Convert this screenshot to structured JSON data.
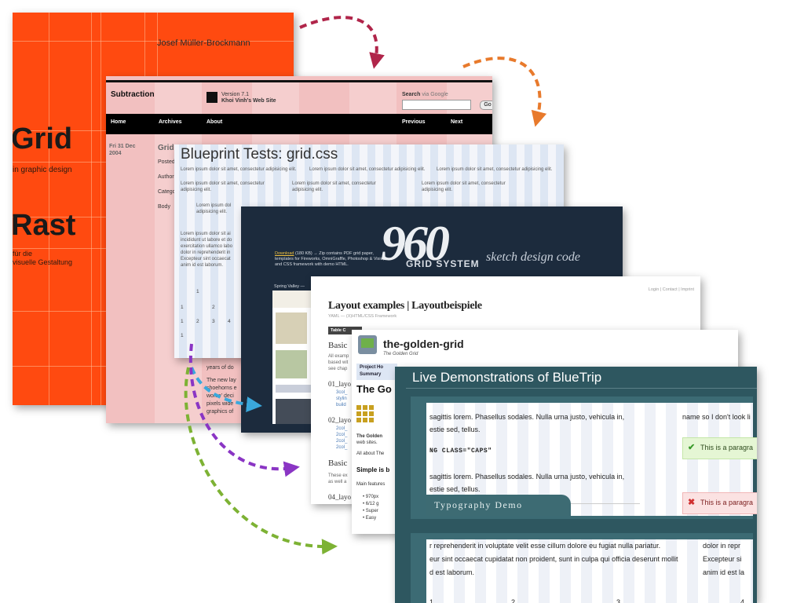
{
  "book": {
    "author": "Josef Müller-Brockmann",
    "title_1": "Grid",
    "subtitle": "in graphic design",
    "title_2": "Rast",
    "line_a": "für die",
    "line_b": "visuelle Gestaltung"
  },
  "subtraction": {
    "logo": "Subtraction",
    "version": "Version 7.1",
    "site_name": "Khoi Vinh’s Web Site",
    "search_label": "Search",
    "search_via": "via Google",
    "go_label": "Go",
    "nav": [
      "Home",
      "Archives",
      "About",
      "Previous",
      "Next"
    ],
    "date_line1": "Fri 31 Dec",
    "date_line2": "2004",
    "post_title": "Grid",
    "meta": [
      "Posted",
      "Author",
      "Catego",
      "Body"
    ],
    "body_text": [
      "years of do",
      "The new lay",
      "shoehorns e",
      "worse' deci",
      "pixels wide",
      "graphics of"
    ]
  },
  "blueprint": {
    "title": "Blueprint Tests: grid.css",
    "lorem_wide": "Lorem ipsum dolor sit amet, consectetur adipisicing elit.",
    "lorem_col_1": "Lorem ipsum dolor sit amet, consectetur",
    "lorem_col_2": "adipisicing elit.",
    "lorem_short_1": "Lorem ipsum dol",
    "lorem_short_2": "adipisicing elit.",
    "para": [
      "Lorem ipsum dolor sit ai",
      "incididunt ut labore et do",
      "exercitation ullamco labo",
      "dolor in reprehenderit in",
      "Excepteur sint occaecat",
      "anim id est laborum."
    ],
    "nums": [
      "1",
      "1",
      "2",
      "1",
      "2",
      "3",
      "4",
      "1"
    ]
  },
  "g960": {
    "logo": "960",
    "grid_system": "GRID SYSTEM",
    "tagline": "sketch design code",
    "download_link": "Download",
    "download_text": "(180 KB) → Zip contains PDF grid paper, templates for Fireworks, OmniGraffle, Photoshop & Visio, and CSS framework with demo HTML.",
    "inner_header": "Spring Valley —"
  },
  "yaml": {
    "login": "Login | Contact | Imprint",
    "title": "Layout examples | Layoutbeispiele",
    "subtitle": "YAML — (X)HTML/CSS Framework",
    "tab": "Table C",
    "basic1": "Basic",
    "intro": [
      "All examp",
      "based wit",
      "see chap"
    ],
    "layout01": "01_layo",
    "links01": [
      "3col_",
      "stylin",
      "build"
    ],
    "layout02": "02_layo",
    "links02": [
      "2col_",
      "2col_",
      "2col_",
      "2col_"
    ],
    "basic2": "Basic",
    "these": [
      "These ex",
      "as well a"
    ],
    "layout04": "04_layo"
  },
  "golden": {
    "title": "the-golden-grid",
    "tagline": "The Golden Grid",
    "proj_1": "Project Ho",
    "proj_2": "Summary",
    "heading": "The Go",
    "desc_bold": "The Golden",
    "desc_rest": "web sites.",
    "about": "All about The",
    "simple": "Simple is b",
    "features": "Main features",
    "bullets": [
      "970px",
      "6/12 g",
      "Super",
      "Easy"
    ]
  },
  "bluetrip": {
    "title": "Live Demonstrations of BlueTrip",
    "lorem_a": "sagittis lorem. Phasellus sodales. Nulla urna justo, vehicula in,",
    "lorem_b": "estie sed, tellus.",
    "caps": "NG CLASS=\"CAPS\"",
    "side_text": "name so I don't look li",
    "success": "This is a paragra",
    "error": "This is a paragra",
    "demo_tab": "Typography Demo",
    "lorem2_a": "r reprehenderit in voluptate velit esse cillum dolore eu fugiat nulla pariatur.",
    "lorem2_b": "eur sint occaecat cupidatat non proident, sunt in culpa qui officia deserunt mollit",
    "lorem2_c": "d est laborum.",
    "side2_a": "dolor in repr",
    "side2_b": "Excepteur si",
    "side2_c": "anim id est la",
    "nums": [
      "1",
      "2",
      "3",
      "4"
    ]
  },
  "colors": {
    "book_orange": "#ff4a10",
    "subtraction_pink": "#f2c0c0",
    "blueprint_bg": "#f3f5fa",
    "g960_navy": "#1c2b3d",
    "bluetrip_teal": "#2e5760",
    "arrow_red": "#b0254a",
    "arrow_orange": "#e87a2c",
    "arrow_blue": "#3aa8dc",
    "arrow_purple": "#8a35c4",
    "arrow_green": "#7db234"
  }
}
